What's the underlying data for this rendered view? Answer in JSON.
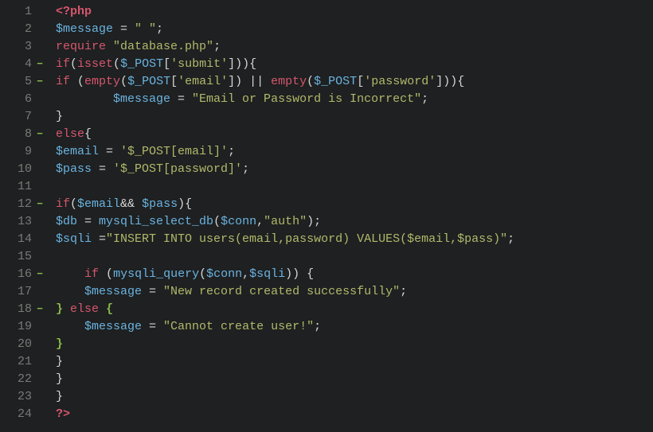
{
  "lines": [
    {
      "num": "1",
      "fold": false,
      "tokens": [
        [
          "tag",
          "<?php"
        ]
      ]
    },
    {
      "num": "2",
      "fold": false,
      "tokens": [
        [
          "var",
          "$message"
        ],
        [
          "op",
          " = "
        ],
        [
          "str",
          "\" \""
        ],
        [
          "punc",
          ";"
        ]
      ]
    },
    {
      "num": "3",
      "fold": false,
      "tokens": [
        [
          "kw",
          "require"
        ],
        [
          "op",
          " "
        ],
        [
          "str",
          "\"database.php\""
        ],
        [
          "punc",
          ";"
        ]
      ]
    },
    {
      "num": "4",
      "fold": true,
      "tokens": [
        [
          "kw",
          "if"
        ],
        [
          "punc",
          "("
        ],
        [
          "kw",
          "isset"
        ],
        [
          "punc",
          "("
        ],
        [
          "var",
          "$_POST"
        ],
        [
          "punc",
          "["
        ],
        [
          "str",
          "'submit'"
        ],
        [
          "punc",
          "])){"
        ]
      ]
    },
    {
      "num": "5",
      "fold": true,
      "tokens": [
        [
          "kw",
          "if"
        ],
        [
          "op",
          " "
        ],
        [
          "punc",
          "("
        ],
        [
          "kw",
          "empty"
        ],
        [
          "punc",
          "("
        ],
        [
          "var",
          "$_POST"
        ],
        [
          "punc",
          "["
        ],
        [
          "str",
          "'email'"
        ],
        [
          "punc",
          "]) || "
        ],
        [
          "kw",
          "empty"
        ],
        [
          "punc",
          "("
        ],
        [
          "var",
          "$_POST"
        ],
        [
          "punc",
          "["
        ],
        [
          "str",
          "'password'"
        ],
        [
          "punc",
          "])){"
        ]
      ]
    },
    {
      "num": "6",
      "fold": false,
      "tokens": [
        [
          "op",
          "        "
        ],
        [
          "var",
          "$message"
        ],
        [
          "op",
          " = "
        ],
        [
          "str",
          "\"Email or Password is Incorrect\""
        ],
        [
          "punc",
          ";"
        ]
      ]
    },
    {
      "num": "7",
      "fold": false,
      "tokens": [
        [
          "punc",
          "}"
        ]
      ]
    },
    {
      "num": "8",
      "fold": true,
      "tokens": [
        [
          "kw",
          "else"
        ],
        [
          "punc",
          "{"
        ]
      ]
    },
    {
      "num": "9",
      "fold": false,
      "tokens": [
        [
          "var",
          "$email"
        ],
        [
          "op",
          " = "
        ],
        [
          "str",
          "'$_POST[email]'"
        ],
        [
          "punc",
          ";"
        ]
      ]
    },
    {
      "num": "10",
      "fold": false,
      "tokens": [
        [
          "var",
          "$pass"
        ],
        [
          "op",
          " = "
        ],
        [
          "str",
          "'$_POST[password]'"
        ],
        [
          "punc",
          ";"
        ]
      ]
    },
    {
      "num": "11",
      "fold": false,
      "tokens": []
    },
    {
      "num": "12",
      "fold": true,
      "tokens": [
        [
          "kw",
          "if"
        ],
        [
          "punc",
          "("
        ],
        [
          "var",
          "$email"
        ],
        [
          "op",
          "&& "
        ],
        [
          "var",
          "$pass"
        ],
        [
          "punc",
          "){"
        ]
      ]
    },
    {
      "num": "13",
      "fold": false,
      "tokens": [
        [
          "var",
          "$db"
        ],
        [
          "op",
          " = "
        ],
        [
          "fn",
          "mysqli_select_db"
        ],
        [
          "punc",
          "("
        ],
        [
          "var",
          "$conn"
        ],
        [
          "punc",
          ","
        ],
        [
          "str",
          "\"auth\""
        ],
        [
          "punc",
          ");"
        ]
      ]
    },
    {
      "num": "14",
      "fold": false,
      "tokens": [
        [
          "var",
          "$sqli"
        ],
        [
          "op",
          " ="
        ],
        [
          "str",
          "\"INSERT INTO users(email,password) VALUES($email,$pass)\""
        ],
        [
          "punc",
          ";"
        ]
      ]
    },
    {
      "num": "15",
      "fold": false,
      "tokens": []
    },
    {
      "num": "16",
      "fold": true,
      "tokens": [
        [
          "op",
          "    "
        ],
        [
          "kw",
          "if"
        ],
        [
          "op",
          " "
        ],
        [
          "punc",
          "("
        ],
        [
          "fn",
          "mysqli_query"
        ],
        [
          "punc",
          "("
        ],
        [
          "var",
          "$conn"
        ],
        [
          "punc",
          ","
        ],
        [
          "var",
          "$sqli"
        ],
        [
          "punc",
          ")) {"
        ]
      ]
    },
    {
      "num": "17",
      "fold": false,
      "tokens": [
        [
          "op",
          "    "
        ],
        [
          "var",
          "$message"
        ],
        [
          "op",
          " = "
        ],
        [
          "str",
          "\"New record created successfully\""
        ],
        [
          "punc",
          ";"
        ]
      ]
    },
    {
      "num": "18",
      "fold": true,
      "tokens": [
        [
          "brace",
          "}"
        ],
        [
          "op",
          " "
        ],
        [
          "kw",
          "else"
        ],
        [
          "op",
          " "
        ],
        [
          "brace",
          "{"
        ]
      ]
    },
    {
      "num": "19",
      "fold": false,
      "tokens": [
        [
          "op",
          "    "
        ],
        [
          "var",
          "$message"
        ],
        [
          "op",
          " = "
        ],
        [
          "str",
          "\"Cannot create user!\""
        ],
        [
          "punc",
          ";"
        ]
      ]
    },
    {
      "num": "20",
      "fold": false,
      "tokens": [
        [
          "brace",
          "}"
        ]
      ]
    },
    {
      "num": "21",
      "fold": false,
      "tokens": [
        [
          "punc",
          "}"
        ]
      ]
    },
    {
      "num": "22",
      "fold": false,
      "tokens": [
        [
          "punc",
          "}"
        ]
      ]
    },
    {
      "num": "23",
      "fold": false,
      "tokens": [
        [
          "punc",
          "}"
        ]
      ]
    },
    {
      "num": "24",
      "fold": false,
      "tokens": [
        [
          "tag",
          "?>"
        ]
      ]
    }
  ]
}
